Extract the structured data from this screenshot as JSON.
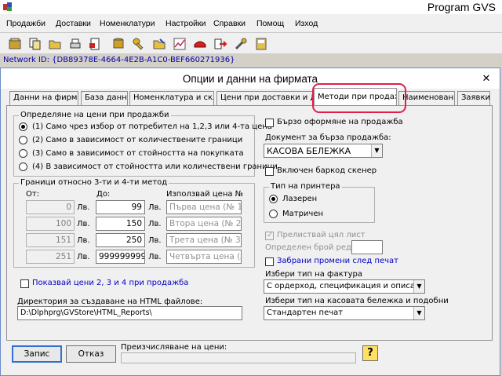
{
  "app": {
    "title": "Program GVS"
  },
  "menu": [
    "Продажби",
    "Доставки",
    "Номенклатури",
    "Настройки",
    "Справки",
    "Помощ",
    "Изход"
  ],
  "toolbar_icons": [
    "archive-icon",
    "copy-icon",
    "folder-open-icon",
    "print-icon",
    "document-red-icon",
    "database-icon",
    "key-icon",
    "folder-edit-icon",
    "chart-icon",
    "phone-icon",
    "arrow-out-icon",
    "tools-icon",
    "save-icon"
  ],
  "network_id": "Network ID: {DB89378E-4664-4E2B-A1C0-BEF660271936}",
  "dialog": {
    "title": "Опции и данни на фирмата",
    "close": "✕",
    "tabs": [
      "Данни на фирмата",
      "База данни",
      "Номенклатура и склад",
      "Цени при доставки и ДДС",
      "Методи при продажби",
      "Наименования",
      "Заявки"
    ],
    "active_tab": "Методи при продажби"
  },
  "price_method": {
    "legend": "Определяне на цени при продажби",
    "options": [
      "(1) Само чрез избор от потребител на 1,2,3 или 4-та цена",
      "(2) Само в зависимост от количествените граници",
      "(3) Само в зависимост от стойността на покупката",
      "(4) В зависимост от стойността или количествени граници"
    ],
    "selected": 0
  },
  "limits": {
    "legend": "Граници относно 3-ти и 4-ти метод",
    "col_from": "От:",
    "col_to": "До:",
    "col_price": "Използвай цена №",
    "currency": "Лв.",
    "rows": [
      {
        "from": "0",
        "to": "99",
        "price": "Първа цена (№ 1)"
      },
      {
        "from": "100",
        "to": "150",
        "price": "Втора цена (№ 2)"
      },
      {
        "from": "151",
        "to": "250",
        "price": "Трета цена (№ 3)"
      },
      {
        "from": "251",
        "to": "9999999999",
        "price": "Четвърта цена (№"
      }
    ]
  },
  "show_prices_label": "Показвай цени 2, 3 и 4 при продажба",
  "html_dir": {
    "label": "Директория за създаване на HTML файлове:",
    "value": "D:\\Dlphprg\\GVStore\\HTML_Reports\\"
  },
  "right": {
    "quick_sale_label": "Бързо оформяне на продажба",
    "doc_type_label": "Документ за бърза продажба:",
    "doc_type_value": "КАСОВА БЕЛЕЖКА",
    "barcode_label": "Включен баркод скенер",
    "printer_type": {
      "legend": "Тип на принтера",
      "options": [
        "Лазерен",
        "Матричен"
      ],
      "selected": 0
    },
    "full_sheet_label": "Прелиствай цял лист",
    "rows_label": "Определен брой редове:",
    "forbid_label": "Забрани промени след печат",
    "invoice_label": "Избери тип на фактура",
    "invoice_value": "С ордерход, спецификация и описание",
    "receipt_label": "Избери тип на касовата бележка и подобни",
    "receipt_value": "Стандартен печат"
  },
  "footer": {
    "save": "Запис",
    "cancel": "Отказ",
    "recalc_label": "Преизчисляване на цени:",
    "help": "?"
  }
}
